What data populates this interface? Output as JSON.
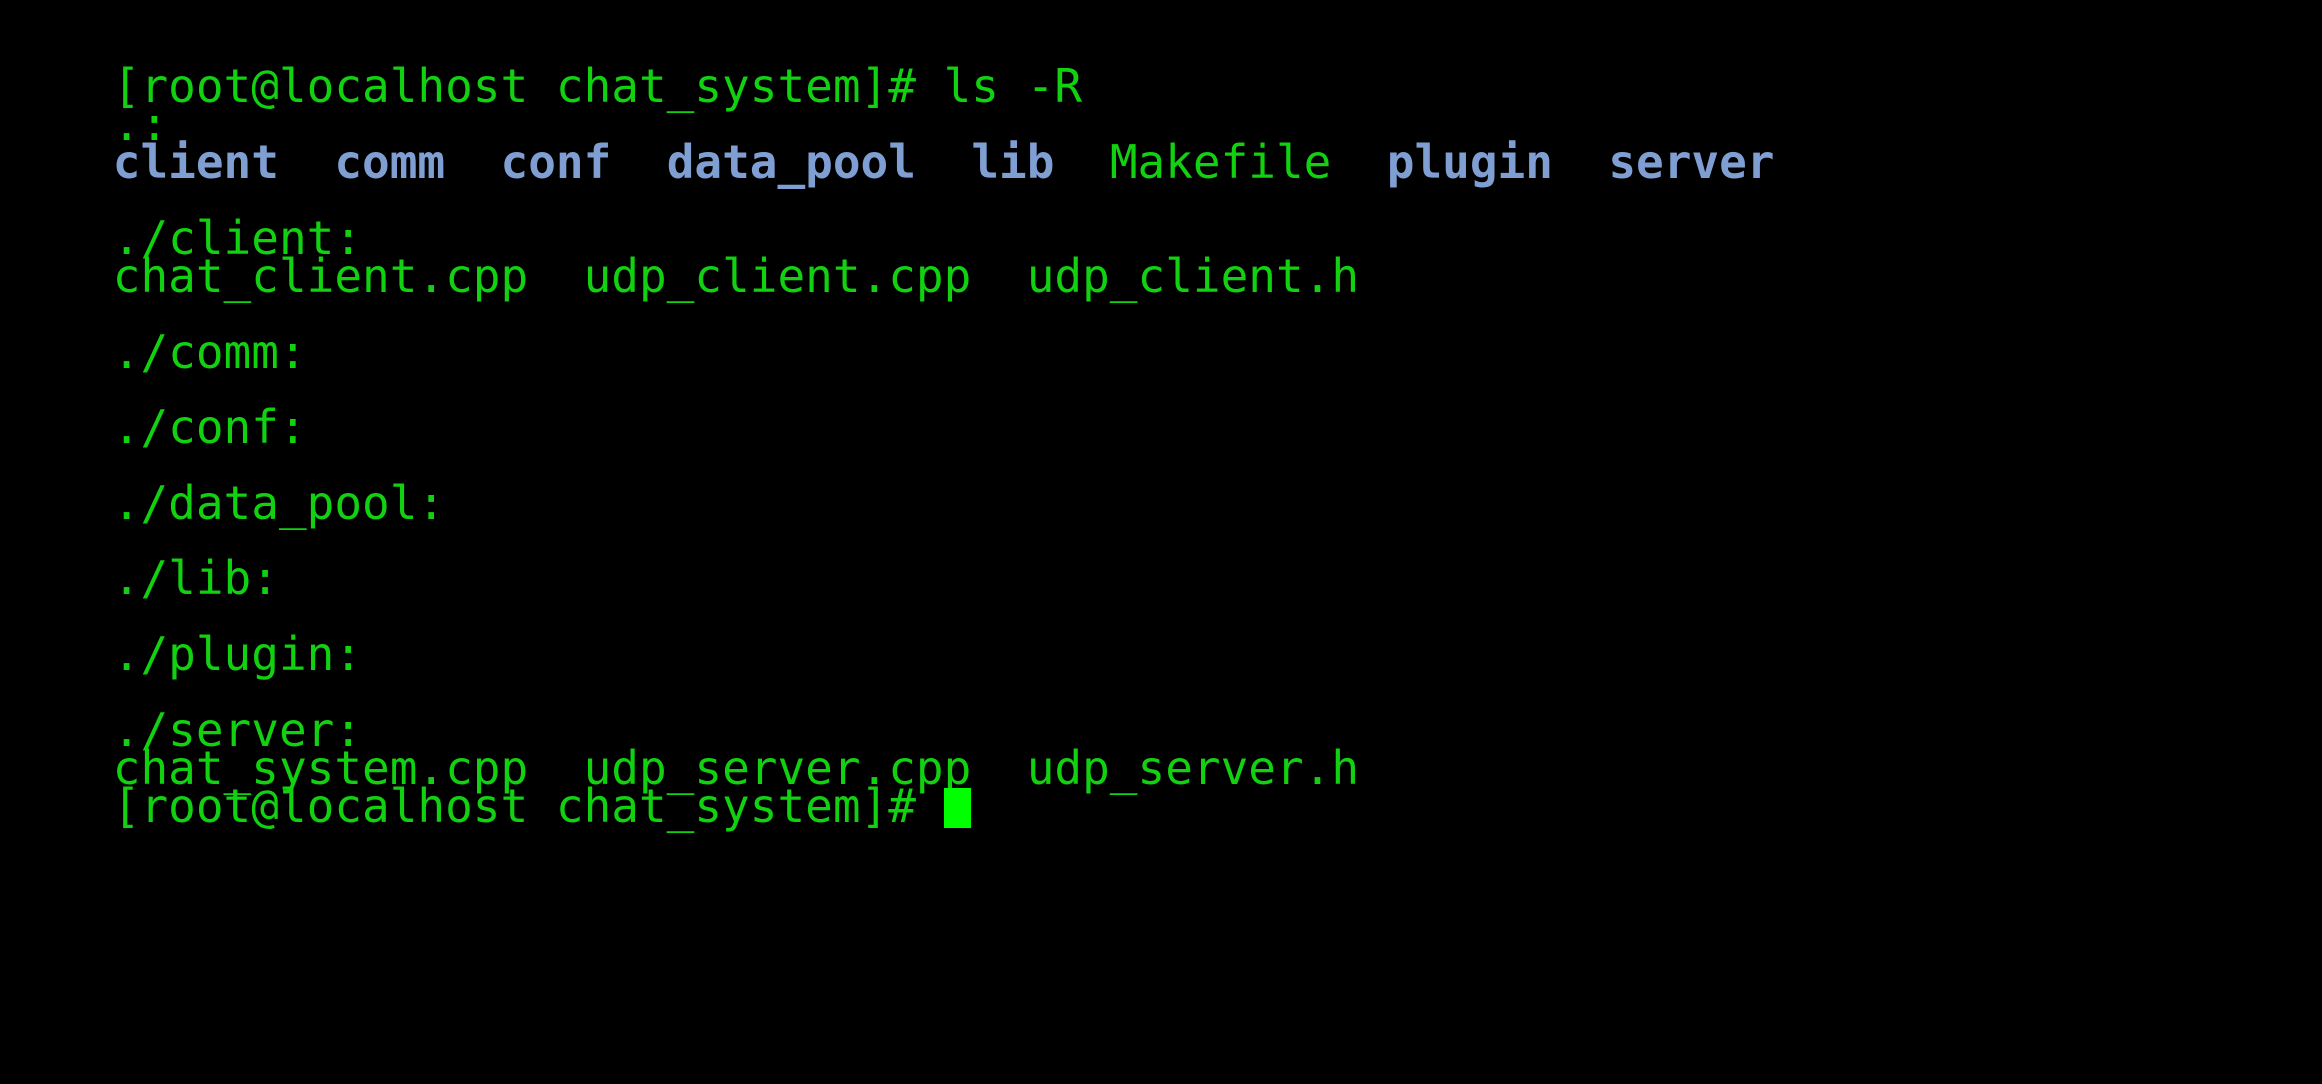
{
  "terminal": {
    "prompt_line": "[root@localhost chat_system]# ls -R",
    "root_header": ".:",
    "root_entries": [
      {
        "name": "client",
        "kind": "directory"
      },
      {
        "name": "comm",
        "kind": "directory"
      },
      {
        "name": "conf",
        "kind": "directory"
      },
      {
        "name": "data_pool",
        "kind": "directory"
      },
      {
        "name": "lib",
        "kind": "directory"
      },
      {
        "name": "Makefile",
        "kind": "file"
      },
      {
        "name": "plugin",
        "kind": "directory"
      },
      {
        "name": "server",
        "kind": "directory"
      }
    ],
    "sections": [
      {
        "header": "./client:",
        "files": [
          "chat_client.cpp",
          "udp_client.cpp",
          "udp_client.h"
        ]
      },
      {
        "header": "./comm:",
        "files": []
      },
      {
        "header": "./conf:",
        "files": []
      },
      {
        "header": "./data_pool:",
        "files": []
      },
      {
        "header": "./lib:",
        "files": []
      },
      {
        "header": "./plugin:",
        "files": []
      },
      {
        "header": "./server:",
        "files": [
          "chat_system.cpp",
          "udp_server.cpp",
          "udp_server.h"
        ]
      }
    ],
    "next_prompt": "[root@localhost chat_system]# "
  },
  "colors": {
    "background": "#000000",
    "text_green": "#11d111",
    "directory_blue": "#7f9fd3",
    "cursor": "#00ff00"
  }
}
